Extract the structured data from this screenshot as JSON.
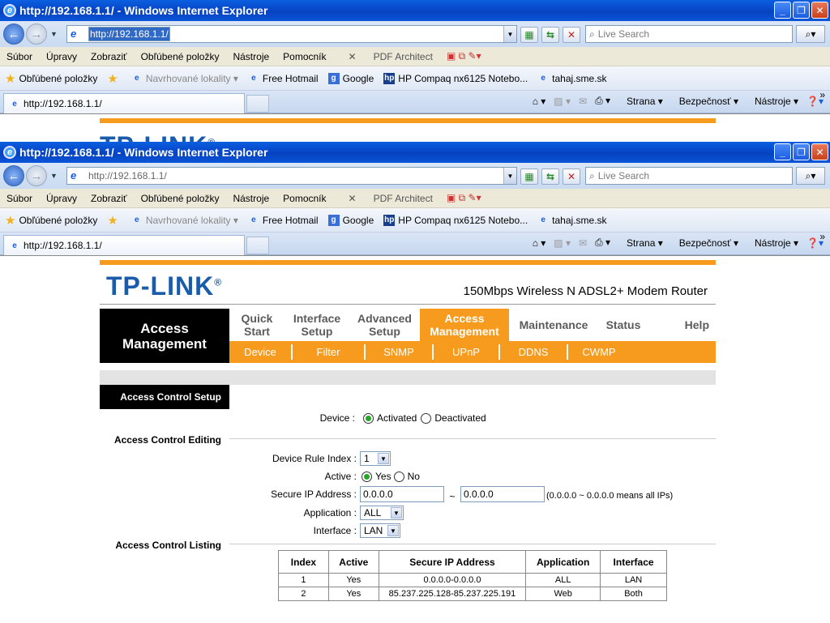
{
  "window": {
    "title": "http://192.168.1.1/ - Windows Internet Explorer",
    "minimize": "_",
    "maximize": "❐",
    "close": "✕"
  },
  "address": {
    "url": "http://192.168.1.1/"
  },
  "search": {
    "placeholder": "Live Search"
  },
  "menu": [
    "Súbor",
    "Úpravy",
    "Zobraziť",
    "Obľúbené položky",
    "Nástroje",
    "Pomocník"
  ],
  "pdf": {
    "label": "PDF Architect"
  },
  "favorites": {
    "label": "Obľúbené položky",
    "items": [
      "Navrhované lokality",
      "Free Hotmail",
      "Google",
      "HP Compaq nx6125 Notebo...",
      "tahaj.sme.sk"
    ]
  },
  "tab": {
    "title": "http://192.168.1.1/"
  },
  "commands": {
    "page": "Strana",
    "safety": "Bezpečnosť",
    "tools": "Nástroje"
  },
  "router": {
    "logo": "TP-LINK",
    "model": "150Mbps Wireless N ADSL2+ Modem Router",
    "section": "Access Management",
    "top_nav": [
      {
        "label": "Quick Start"
      },
      {
        "label": "Interface Setup"
      },
      {
        "label": "Advanced Setup"
      },
      {
        "label": "Access Management"
      },
      {
        "label": "Maintenance"
      },
      {
        "label": "Status"
      },
      {
        "label": "Help"
      }
    ],
    "sub_nav": [
      "Device",
      "Filter",
      "SNMP",
      "UPnP",
      "DDNS",
      "CWMP"
    ],
    "left": {
      "setup": "Access Control Setup",
      "editing": "Access Control Editing",
      "listing": "Access Control Listing"
    },
    "form": {
      "device_label": "Device :",
      "device_options": [
        "Activated",
        "Deactivated"
      ],
      "rule_index_label": "Device Rule Index :",
      "rule_index_value": "1",
      "active_label": "Active :",
      "active_options": [
        "Yes",
        "No"
      ],
      "secure_ip_label": "Secure IP Address :",
      "ip_start": "0.0.0.0",
      "ip_sep": "~",
      "ip_end": "0.0.0.0",
      "ip_note": "(0.0.0.0 ~ 0.0.0.0 means all IPs)",
      "application_label": "Application :",
      "application_value": "ALL",
      "interface_label": "Interface :",
      "interface_value": "LAN"
    },
    "table": {
      "headers": [
        "Index",
        "Active",
        "Secure IP Address",
        "Application",
        "Interface"
      ],
      "rows": [
        [
          "1",
          "Yes",
          "0.0.0.0-0.0.0.0",
          "ALL",
          "LAN"
        ],
        [
          "2",
          "Yes",
          "85.237.225.128-85.237.225.191",
          "Web",
          "Both"
        ]
      ]
    }
  }
}
